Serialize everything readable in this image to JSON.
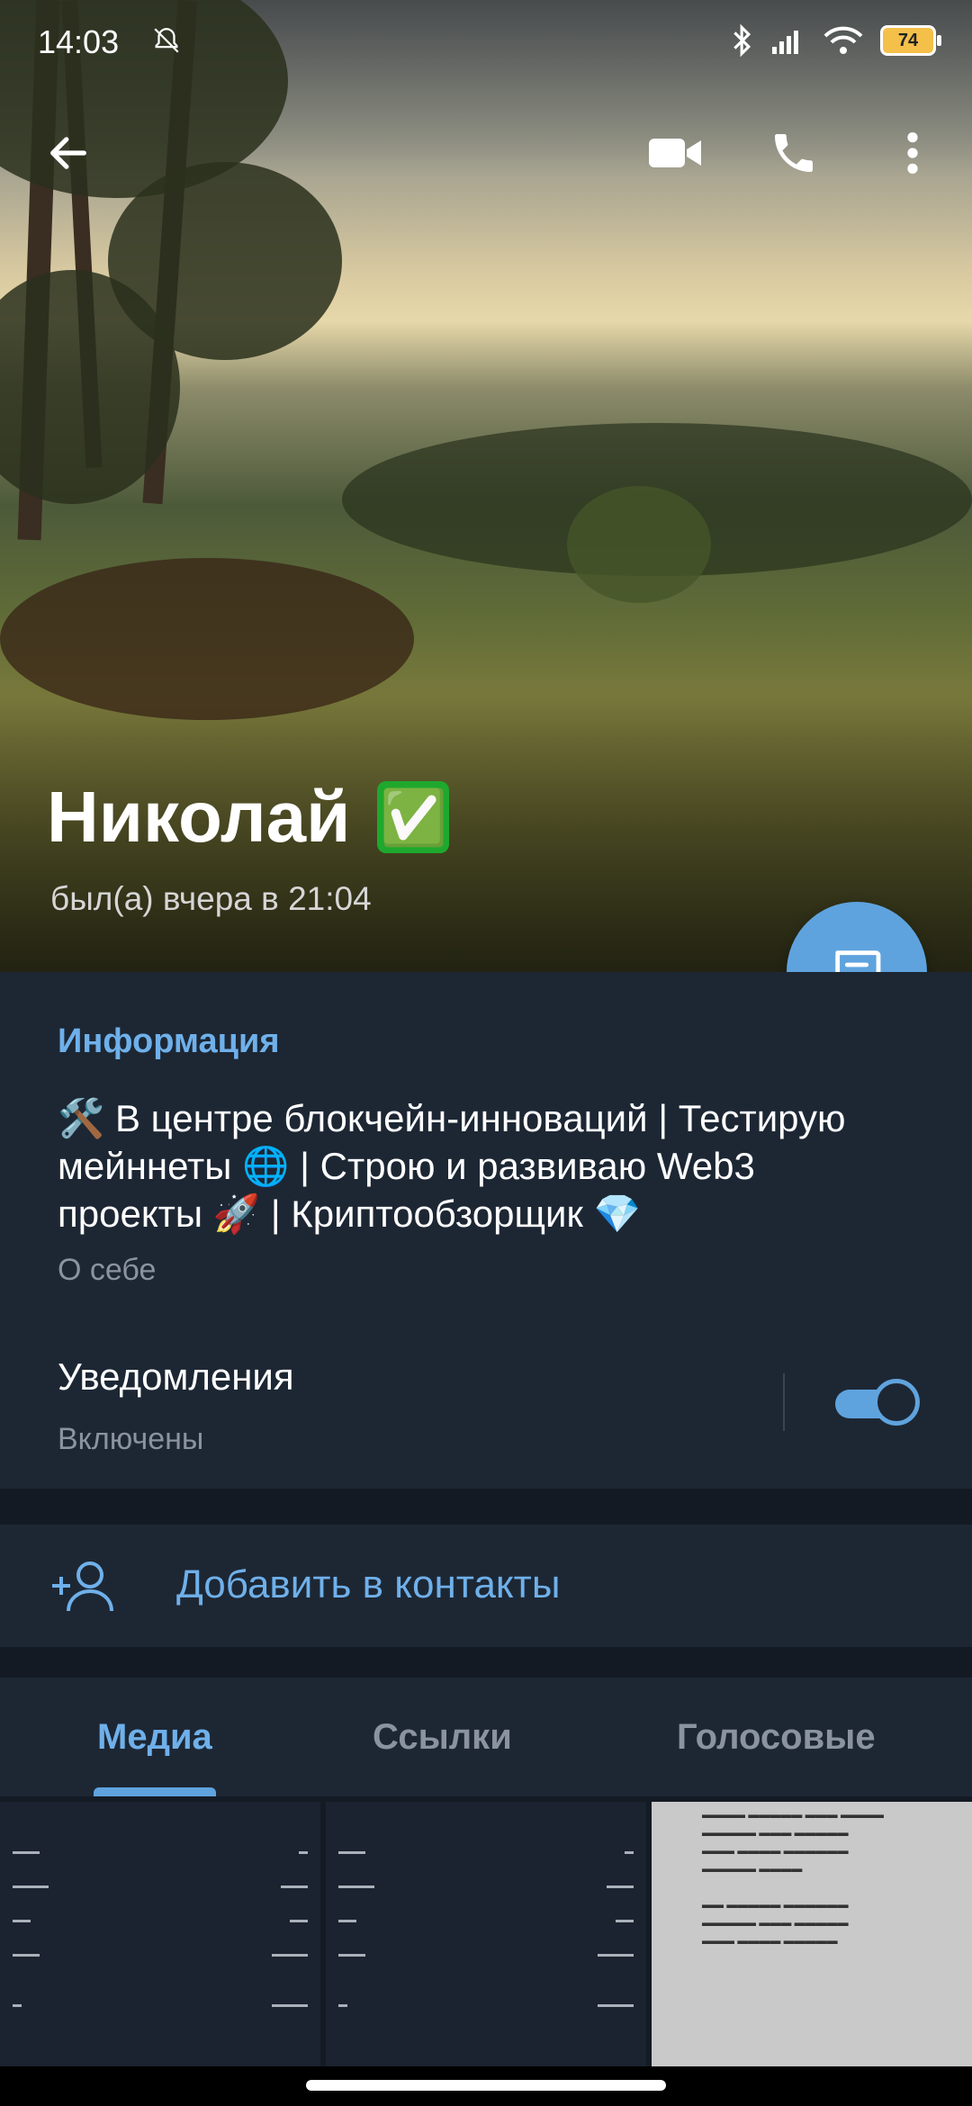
{
  "status": {
    "time": "14:03",
    "battery": "74"
  },
  "profile": {
    "name": "Николай",
    "verified_badge": "✅",
    "last_seen": "был(а) вчера в 21:04"
  },
  "info": {
    "title": "Информация",
    "bio_line1": "🛠️ В центре блокчейн-инноваций | Тестирую",
    "bio_line2": "мейннеты 🌐 | Строю и развиваю Web3",
    "bio_line3": "проекты 🚀 | Криптообзорщик 💎",
    "bio_caption": "О себе",
    "notifications_label": "Уведомления",
    "notifications_status": "Включены"
  },
  "actions": {
    "add_contact": "Добавить в контакты"
  },
  "tabs": [
    {
      "label": "Медиа",
      "active": true
    },
    {
      "label": "Ссылки",
      "active": false
    },
    {
      "label": "Голосовые",
      "active": false
    }
  ],
  "toggle": {
    "notifications_on": true
  },
  "colors": {
    "accent": "#5fa3de",
    "panel": "#1d2734",
    "verified": "#1fa82e"
  },
  "icons": {
    "back": "back-arrow-icon",
    "video": "video-call-icon",
    "phone": "phone-icon",
    "more": "more-vert-icon",
    "message": "message-icon",
    "add_contact": "add-person-icon"
  }
}
